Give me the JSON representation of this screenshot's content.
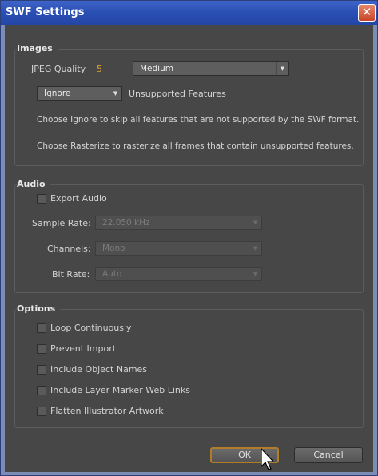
{
  "window": {
    "title": "SWF Settings",
    "close_glyph": "✕"
  },
  "images": {
    "title": "Images",
    "jpeg_quality_label": "JPEG Quality",
    "jpeg_quality_value": "5",
    "quality_select": "Medium",
    "unsupported_select": "Ignore",
    "unsupported_label": "Unsupported Features",
    "help_ignore": "Choose Ignore to skip all features that are not supported by the SWF format.",
    "help_rasterize": "Choose Rasterize to rasterize all frames that contain unsupported features."
  },
  "audio": {
    "title": "Audio",
    "export_label": "Export Audio",
    "export_checked": false,
    "sample_rate_label": "Sample Rate:",
    "sample_rate_value": "22.050 kHz",
    "channels_label": "Channels:",
    "channels_value": "Mono",
    "bit_rate_label": "Bit Rate:",
    "bit_rate_value": "Auto"
  },
  "options": {
    "title": "Options",
    "items": [
      {
        "label": "Loop Continuously",
        "checked": false
      },
      {
        "label": "Prevent Import",
        "checked": false
      },
      {
        "label": "Include Object Names",
        "checked": false
      },
      {
        "label": "Include Layer Marker Web Links",
        "checked": false
      },
      {
        "label": "Flatten Illustrator Artwork",
        "checked": false
      }
    ]
  },
  "buttons": {
    "ok": "OK",
    "cancel": "Cancel"
  },
  "colors": {
    "title_bar": "#2a4fb3",
    "panel": "#474747",
    "accent": "#e0a020",
    "default_button_border": "#b27d28"
  }
}
